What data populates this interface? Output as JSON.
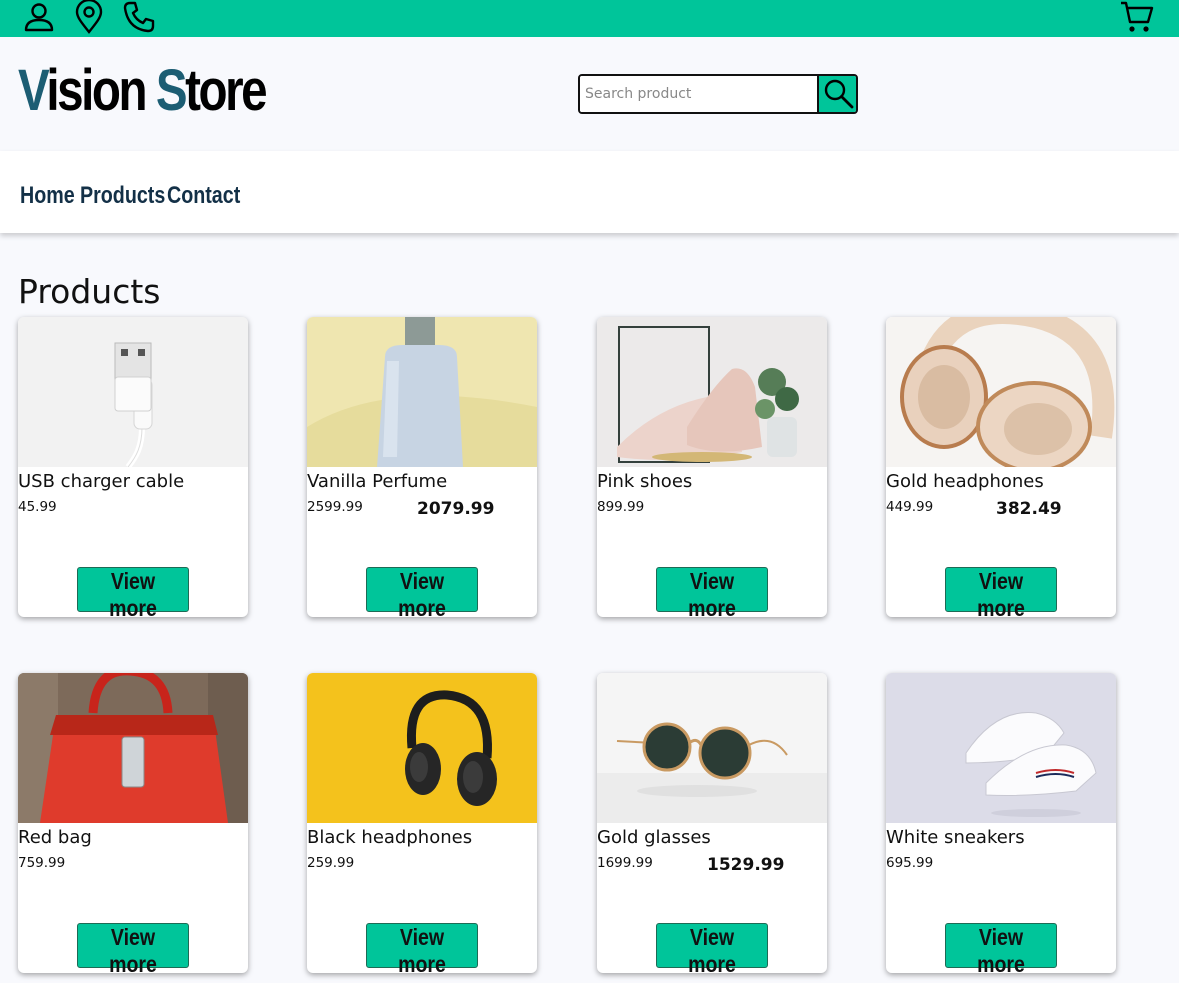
{
  "topbar": {
    "icons": [
      "user-icon",
      "location-pin-icon",
      "phone-icon",
      "cart-icon"
    ],
    "background": "#00c59a"
  },
  "header": {
    "logo_first_cap": "V",
    "logo_first_rest": "ision",
    "logo_second_cap": "S",
    "logo_second_rest": "tore",
    "logo_accent": "#1c5d73"
  },
  "search": {
    "placeholder": "Search product",
    "value": "",
    "button_icon": "search-icon"
  },
  "nav": {
    "items": [
      "Home",
      "Products",
      "Contact"
    ]
  },
  "main": {
    "title": "Products",
    "products": [
      {
        "name": "USB charger cable",
        "price": "45.99",
        "sale": "",
        "button": "View more",
        "image": "usb-cable"
      },
      {
        "name": "Vanilla Perfume",
        "price": "2599.99",
        "sale": "2079.99",
        "button": "View more",
        "image": "perfume-bottle"
      },
      {
        "name": "Pink shoes",
        "price": "899.99",
        "sale": "",
        "button": "View more",
        "image": "pink-shoes"
      },
      {
        "name": "Gold headphones",
        "price": "449.99",
        "sale": "382.49",
        "button": "View more",
        "image": "gold-headphones"
      },
      {
        "name": "Red bag",
        "price": "759.99",
        "sale": "",
        "button": "View more",
        "image": "red-bag"
      },
      {
        "name": "Black headphones",
        "price": "259.99",
        "sale": "",
        "button": "View more",
        "image": "black-headphones"
      },
      {
        "name": "Gold glasses",
        "price": "1699.99",
        "sale": "1529.99",
        "button": "View more",
        "image": "gold-glasses"
      },
      {
        "name": "White sneakers",
        "price": "695.99",
        "sale": "",
        "button": "View more",
        "image": "white-sneakers"
      }
    ]
  },
  "colors": {
    "accent": "#00c59a",
    "nav_text": "#133047",
    "page_bg": "#f8f9fd"
  }
}
